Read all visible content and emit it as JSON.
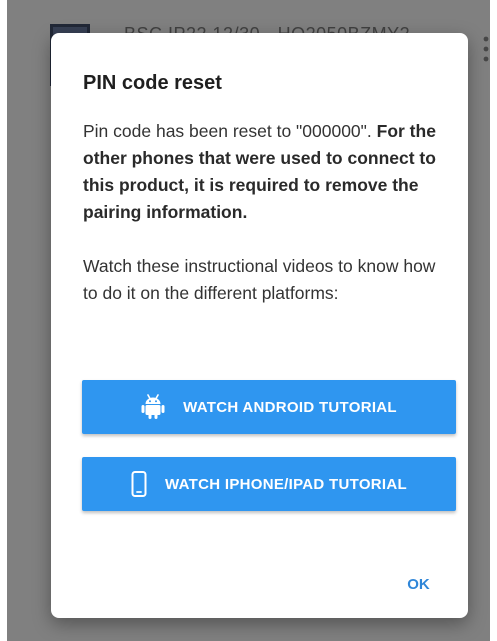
{
  "background": {
    "list_item_title": "BSC IP22 12/30 - HQ2050BZMY2"
  },
  "dialog": {
    "title": "PIN code reset",
    "message_plain": "Pin code has been reset to \"000000\".",
    "message_bold": "For the other phones that were used to connect to this product, it is required to remove the pairing information.",
    "instruction": "Watch these instructional videos to know how to do it on the different platforms:",
    "android_button_label": "WATCH ANDROID TUTORIAL",
    "iphone_button_label": "WATCH IPHONE/IPAD TUTORIAL",
    "ok_label": "OK"
  },
  "icons": {
    "android": "android-icon",
    "phone": "smartphone-icon",
    "more": "more-vert-icon"
  },
  "colors": {
    "accent_button": "#2f96f0",
    "ok_text": "#2f86d8",
    "scrim": "rgba(0,0,0,0.42)"
  }
}
